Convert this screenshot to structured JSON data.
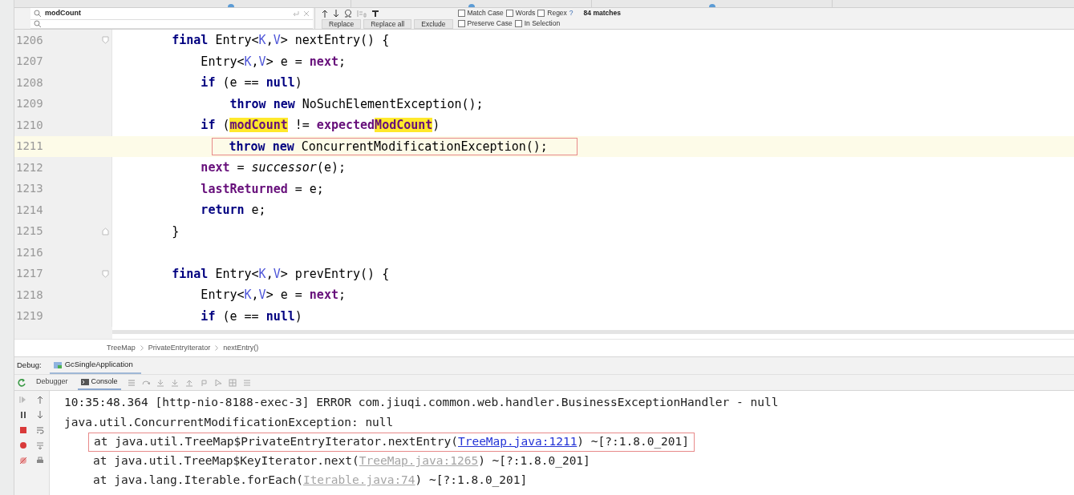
{
  "find_bar": {
    "search_value": "modCount",
    "options": [
      {
        "label": "Match Case",
        "checked": false
      },
      {
        "label": "Words",
        "checked": false
      },
      {
        "label": "Regex",
        "checked": false
      }
    ],
    "help": "?",
    "match_count": "84 matches",
    "buttons": [
      "Replace",
      "Replace all",
      "Exclude"
    ],
    "replace_options": [
      {
        "label": "Preserve Case",
        "checked": false
      },
      {
        "label": "In Selection",
        "checked": false
      }
    ]
  },
  "editor": {
    "lines": [
      {
        "number": "1206",
        "current": false,
        "boxed": false,
        "fold_start": true,
        "fold_end": false,
        "tokens": [
          {
            "kind": "keyword",
            "text": "final"
          },
          {
            "kind": "plain",
            "text": " Entry<"
          },
          {
            "kind": "type_param",
            "text": "K"
          },
          {
            "kind": "plain",
            "text": ","
          },
          {
            "kind": "type_param",
            "text": "V"
          },
          {
            "kind": "plain",
            "text": "> nextEntry() {"
          }
        ],
        "children": [
          {
            "number": "1207",
            "current": false,
            "boxed": false,
            "fold_start": false,
            "fold_end": false,
            "tokens": [
              {
                "kind": "plain",
                "text": "Entry<"
              },
              {
                "kind": "type_param",
                "text": "K"
              },
              {
                "kind": "plain",
                "text": ","
              },
              {
                "kind": "type_param",
                "text": "V"
              },
              {
                "kind": "plain",
                "text": "> e = "
              },
              {
                "kind": "field",
                "text": "next"
              },
              {
                "kind": "plain",
                "text": ";"
              }
            ]
          },
          {
            "number": "1208",
            "current": false,
            "boxed": false,
            "fold_start": false,
            "fold_end": false,
            "tokens": [
              {
                "kind": "keyword",
                "text": "if"
              },
              {
                "kind": "plain",
                "text": " (e == "
              },
              {
                "kind": "keyword",
                "text": "null"
              },
              {
                "kind": "plain",
                "text": ")"
              }
            ],
            "children": [
              {
                "number": "1209",
                "current": false,
                "boxed": false,
                "fold_start": false,
                "fold_end": false,
                "tokens": [
                  {
                    "kind": "keyword",
                    "text": "throw new"
                  },
                  {
                    "kind": "plain",
                    "text": " NoSuchElementException();"
                  }
                ]
              }
            ]
          },
          {
            "number": "1210",
            "current": false,
            "boxed": false,
            "fold_start": false,
            "fold_end": false,
            "tokens": [
              {
                "kind": "keyword",
                "text": "if"
              },
              {
                "kind": "plain",
                "text": " ("
              },
              {
                "kind": "match",
                "text": "modCount"
              },
              {
                "kind": "plain",
                "text": " != "
              },
              {
                "kind": "field",
                "text": "expected"
              },
              {
                "kind": "match",
                "text": "ModCount"
              },
              {
                "kind": "plain",
                "text": ")"
              }
            ],
            "children": [
              {
                "number": "1211",
                "current": true,
                "boxed": true,
                "fold_start": false,
                "fold_end": false,
                "tokens": [
                  {
                    "kind": "keyword",
                    "text": "throw new"
                  },
                  {
                    "kind": "plain",
                    "text": " ConcurrentModificationException();"
                  }
                ]
              }
            ]
          },
          {
            "number": "1212",
            "current": false,
            "boxed": false,
            "fold_start": false,
            "fold_end": false,
            "tokens": [
              {
                "kind": "field",
                "text": "next"
              },
              {
                "kind": "plain",
                "text": " = "
              },
              {
                "kind": "italic",
                "text": "successor"
              },
              {
                "kind": "plain",
                "text": "(e);"
              }
            ]
          },
          {
            "number": "1213",
            "current": false,
            "boxed": false,
            "fold_start": false,
            "fold_end": false,
            "tokens": [
              {
                "kind": "field",
                "text": "lastReturned"
              },
              {
                "kind": "plain",
                "text": " = e;"
              }
            ]
          },
          {
            "number": "1214",
            "current": false,
            "boxed": false,
            "fold_start": false,
            "fold_end": false,
            "tokens": [
              {
                "kind": "keyword",
                "text": "return"
              },
              {
                "kind": "plain",
                "text": " e;"
              }
            ]
          }
        ]
      },
      {
        "number": "1215",
        "current": false,
        "boxed": false,
        "fold_start": false,
        "fold_end": true,
        "tokens": [
          {
            "kind": "plain",
            "text": "}"
          }
        ]
      },
      {
        "number": "1216",
        "current": false,
        "boxed": false,
        "fold_start": false,
        "fold_end": false
      },
      {
        "number": "1217",
        "current": false,
        "boxed": false,
        "fold_start": true,
        "fold_end": false,
        "tokens": [
          {
            "kind": "keyword",
            "text": "final"
          },
          {
            "kind": "plain",
            "text": " Entry<"
          },
          {
            "kind": "type_param",
            "text": "K"
          },
          {
            "kind": "plain",
            "text": ","
          },
          {
            "kind": "type_param",
            "text": "V"
          },
          {
            "kind": "plain",
            "text": "> prevEntry() {"
          }
        ],
        "children": [
          {
            "number": "1218",
            "current": false,
            "boxed": false,
            "fold_start": false,
            "fold_end": false,
            "tokens": [
              {
                "kind": "plain",
                "text": "Entry<"
              },
              {
                "kind": "type_param",
                "text": "K"
              },
              {
                "kind": "plain",
                "text": ","
              },
              {
                "kind": "type_param",
                "text": "V"
              },
              {
                "kind": "plain",
                "text": "> e = "
              },
              {
                "kind": "field",
                "text": "next"
              },
              {
                "kind": "plain",
                "text": ";"
              }
            ]
          },
          {
            "number": "1219",
            "current": false,
            "boxed": false,
            "fold_start": false,
            "fold_end": false,
            "tokens": [
              {
                "kind": "keyword",
                "text": "if"
              },
              {
                "kind": "plain",
                "text": " (e == "
              },
              {
                "kind": "keyword",
                "text": "null"
              },
              {
                "kind": "plain",
                "text": ")"
              }
            ]
          }
        ]
      }
    ]
  },
  "breadcrumb": [
    "TreeMap",
    "PrivateEntryIterator",
    "nextEntry()"
  ],
  "debug": {
    "label": "Debug:",
    "session": "GcSingleApplication",
    "tabs": [
      {
        "label": "Debugger",
        "selected": false
      },
      {
        "label": "Console",
        "selected": true
      }
    ],
    "console_lines": [
      {
        "kind": "message",
        "boxed": false,
        "parts": [
          {
            "kind": "text",
            "text": "10:35:48.364 [http-nio-8188-exec-3] ERROR com.jiuqi.common.web.handler.BusinessExceptionHandler - null"
          }
        ]
      },
      {
        "kind": "message",
        "boxed": false,
        "parts": [
          {
            "kind": "text",
            "text": "java.util.ConcurrentModificationException: null"
          }
        ]
      },
      {
        "kind": "frame",
        "boxed": true,
        "parts": [
          {
            "kind": "text",
            "text": "at java.util.TreeMap$PrivateEntryIterator.nextEntry("
          },
          {
            "kind": "link",
            "dim": false,
            "text": "TreeMap.java:1211"
          },
          {
            "kind": "text",
            "text": ") ~[?:1.8.0_201]"
          }
        ]
      },
      {
        "kind": "frame",
        "boxed": false,
        "parts": [
          {
            "kind": "text",
            "text": "at java.util.TreeMap$KeyIterator.next("
          },
          {
            "kind": "link",
            "dim": true,
            "text": "TreeMap.java:1265"
          },
          {
            "kind": "text",
            "text": ") ~[?:1.8.0_201]"
          }
        ]
      },
      {
        "kind": "frame",
        "boxed": false,
        "parts": [
          {
            "kind": "text",
            "text": "at java.lang.Iterable.forEach("
          },
          {
            "kind": "link",
            "dim": true,
            "text": "Iterable.java:74"
          },
          {
            "kind": "text",
            "text": ") ~[?:1.8.0_201]"
          }
        ]
      }
    ]
  }
}
